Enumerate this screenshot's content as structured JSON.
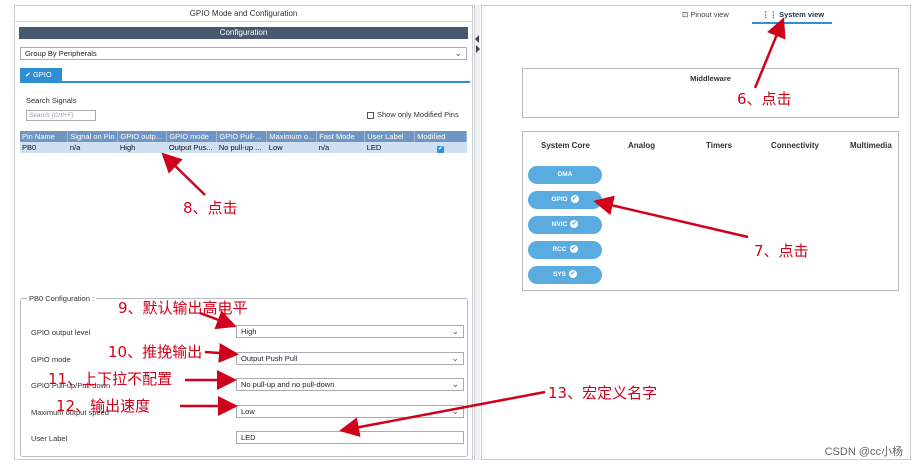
{
  "left": {
    "window_title": "GPIO Mode and Configuration",
    "configuration_label": "Configuration",
    "group_select": "Group By Peripherals",
    "tab_gpio": "GPIO",
    "search_signals_label": "Search Signals",
    "search_placeholder": "Search (Crtl+F)",
    "show_modified_label": "Show only Modified Pins",
    "table": {
      "headers": [
        "Pin Name",
        "Signal on Pin",
        "GPIO outp...",
        "GPIO mode",
        "GPIO Pull-...",
        "Maximum o...",
        "Fast Mode",
        "User Label",
        "Modified"
      ],
      "row": [
        "PB0",
        "n/a",
        "High",
        "Output Pus...",
        "No pull-up ...",
        "Low",
        "n/a",
        "LED"
      ]
    },
    "pb0": {
      "title": "PB0 Configuration :",
      "output_level_label": "GPIO output level",
      "output_level_value": "High",
      "mode_label": "GPIO mode",
      "mode_value": "Output Push Pull",
      "pull_label": "GPIO Pull-up/Pull-down",
      "pull_value": "No pull-up and no pull-down",
      "speed_label": "Maximum output speed",
      "speed_value": "Low",
      "user_label_label": "User Label",
      "user_label_value": "LED"
    }
  },
  "right": {
    "pinout_view": "Pinout view",
    "system_view": "System view",
    "middleware": "Middleware",
    "categories": [
      "System Core",
      "Analog",
      "Timers",
      "Connectivity",
      "Multimedia"
    ],
    "items": [
      "DMA",
      "GPIO",
      "NVIC",
      "RCC",
      "SYS"
    ]
  },
  "annotations": {
    "a6": "6、点击",
    "a7": "7、点击",
    "a8": "8、点击",
    "a9": "9、默认输出高电平",
    "a10": "10、推挽输出",
    "a11": "11、上下拉不配置",
    "a12": "12、输出速度",
    "a13": "13、宏定义名字"
  },
  "watermark": "CSDN @cc小杨",
  "colors": {
    "accent": "#2f8fd0",
    "header_bar": "#46596e",
    "annotation": "#d0021b",
    "pill": "#5aace0"
  }
}
